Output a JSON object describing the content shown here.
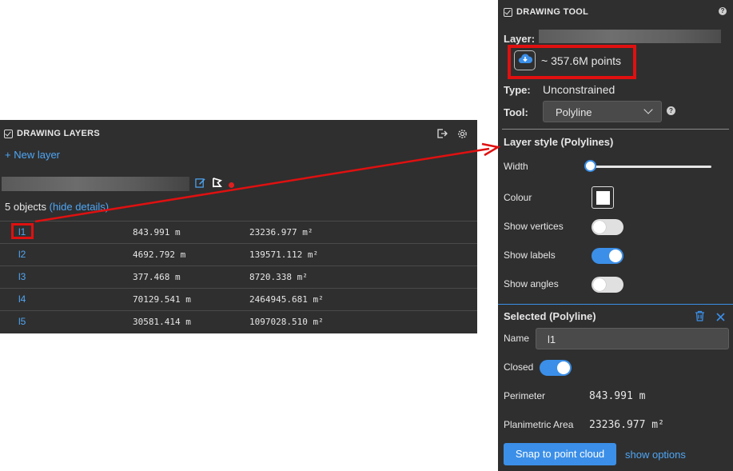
{
  "layers_panel": {
    "title": "DRAWING LAYERS",
    "new_layer": "+ New layer",
    "object_count": "5 objects",
    "hide_details": "(hide details)",
    "rows": [
      {
        "name": "l1",
        "perimeter": "843.991 m",
        "area": "23236.977 m²"
      },
      {
        "name": "l2",
        "perimeter": "4692.792 m",
        "area": "139571.112 m²"
      },
      {
        "name": "l3",
        "perimeter": "377.468 m",
        "area": "8720.338 m²"
      },
      {
        "name": "l4",
        "perimeter": "70129.541 m",
        "area": "2464945.681 m²"
      },
      {
        "name": "l5",
        "perimeter": "30581.414 m",
        "area": "1097028.510 m²"
      }
    ]
  },
  "tool_panel": {
    "title": "DRAWING TOOL",
    "help": "?",
    "layer_label": "Layer:",
    "points": "~ 357.6M points",
    "type_label": "Type:",
    "type_value": "Unconstrained",
    "tool_label": "Tool:",
    "tool_value": "Polyline",
    "style_title": "Layer style (Polylines)",
    "width_label": "Width",
    "width_value": 0.0,
    "colour_label": "Colour",
    "colour_value": "#ffffff",
    "show_vertices_label": "Show vertices",
    "show_vertices": false,
    "show_labels_label": "Show labels",
    "show_labels": true,
    "show_angles_label": "Show angles",
    "show_angles": false,
    "selected_title": "Selected (Polyline)",
    "name_label": "Name",
    "name_value": "l1",
    "closed_label": "Closed",
    "closed": true,
    "perimeter_label": "Perimeter",
    "perimeter_value": "843.991 m",
    "area_label": "Planimetric Area",
    "area_value": "23236.977 m²",
    "snap_button": "Snap to point cloud",
    "show_options": "show options"
  },
  "colors": {
    "panel_bg": "#2f2f2f",
    "accent": "#3b8fe8",
    "link": "#4ea6f5",
    "annotation_red": "#e01010"
  }
}
